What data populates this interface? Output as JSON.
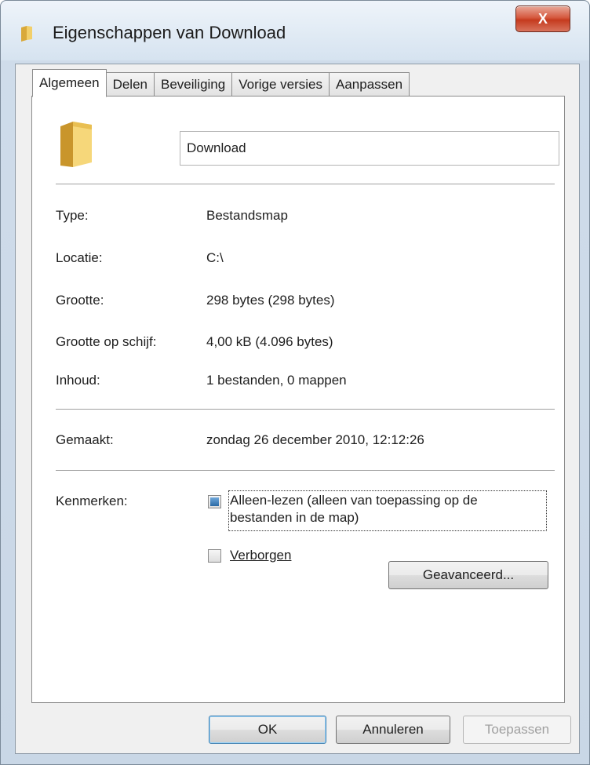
{
  "window": {
    "title": "Eigenschappen van Download",
    "close_label": "X"
  },
  "tabs": [
    {
      "label": "Algemeen"
    },
    {
      "label": "Delen"
    },
    {
      "label": "Beveiliging"
    },
    {
      "label": "Vorige versies"
    },
    {
      "label": "Aanpassen"
    }
  ],
  "general": {
    "name_value": "Download",
    "props": [
      {
        "label": "Type:",
        "value": "Bestandsmap"
      },
      {
        "label": "Locatie:",
        "value": "C:\\"
      },
      {
        "label": "Grootte:",
        "value": "298 bytes (298 bytes)"
      },
      {
        "label": "Grootte op schijf:",
        "value": "4,00 kB (4.096 bytes)"
      },
      {
        "label": "Inhoud:",
        "value": "1 bestanden, 0 mappen"
      }
    ],
    "created_label": "Gemaakt:",
    "created_value": "zondag 26 december 2010, 12:12:26",
    "attributes_label": "Kenmerken:",
    "readonly_label_line1": "Alleen-lezen (alleen van toepassing op de",
    "readonly_label_line2": "bestanden in de map)",
    "hidden_label": "Verborgen",
    "advanced_button": "Geavanceerd..."
  },
  "footer": {
    "ok": "OK",
    "cancel": "Annuleren",
    "apply": "Toepassen"
  },
  "icons": {
    "title": "folder-icon",
    "big": "folder-icon"
  }
}
